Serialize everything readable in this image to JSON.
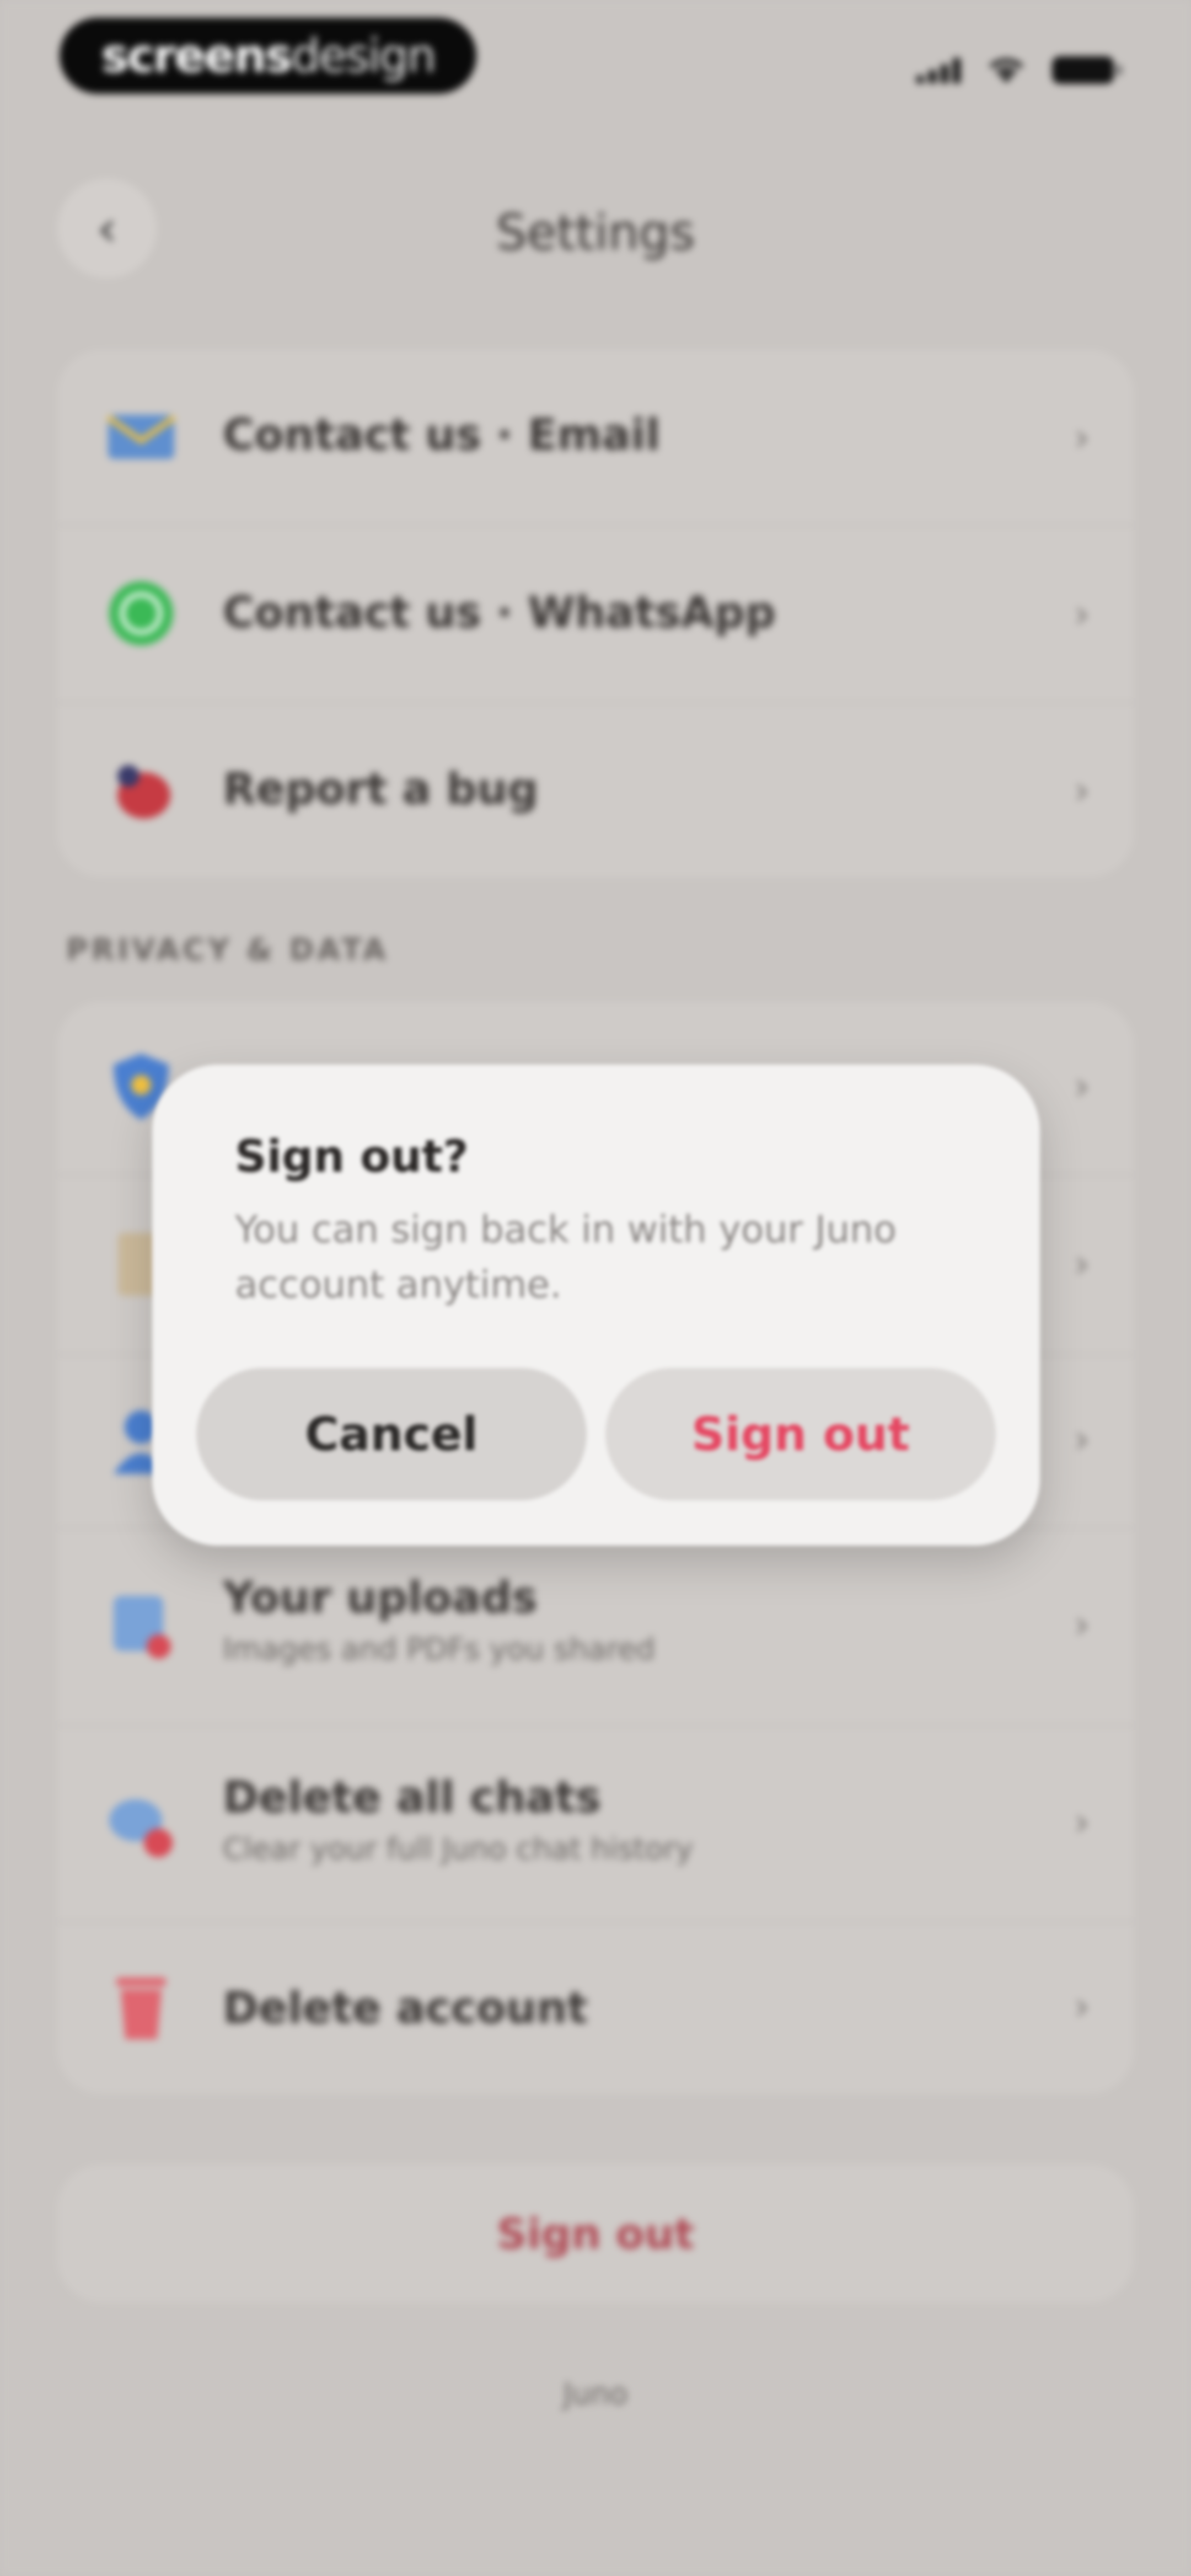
{
  "brand": {
    "bold": "screens",
    "light": "design"
  },
  "header": {
    "back_glyph": "‹",
    "title": "Settings"
  },
  "support_items": [
    {
      "icon": "envelope-icon",
      "label": "Contact us · Email"
    },
    {
      "icon": "whatsapp-icon",
      "label": "Contact us · WhatsApp"
    },
    {
      "icon": "bug-icon",
      "label": "Report a bug"
    }
  ],
  "privacy": {
    "section_label": "PRIVACY & DATA",
    "items": [
      {
        "icon": "shield-icon",
        "label": "",
        "subtitle": ""
      },
      {
        "icon": "document-icon",
        "label": "",
        "subtitle": ""
      },
      {
        "icon": "user-icon",
        "label": "",
        "subtitle": ""
      },
      {
        "icon": "uploads-icon",
        "label": "Your uploads",
        "subtitle": "Images and PDFs you shared"
      },
      {
        "icon": "chat-delete-icon",
        "label": "Delete all chats",
        "subtitle": "Clear your full Juno chat history"
      },
      {
        "icon": "trash-icon",
        "label": "Delete account",
        "subtitle": ""
      }
    ]
  },
  "sign_out_label": "Sign out",
  "footer": "Juno",
  "dialog": {
    "title": "Sign out?",
    "message": "You can sign back in with your Juno account anytime.",
    "cancel_label": "Cancel",
    "confirm_label": "Sign out"
  },
  "colors": {
    "accent": "#e54863",
    "background": "#c9c5c2"
  },
  "chevron": "›"
}
